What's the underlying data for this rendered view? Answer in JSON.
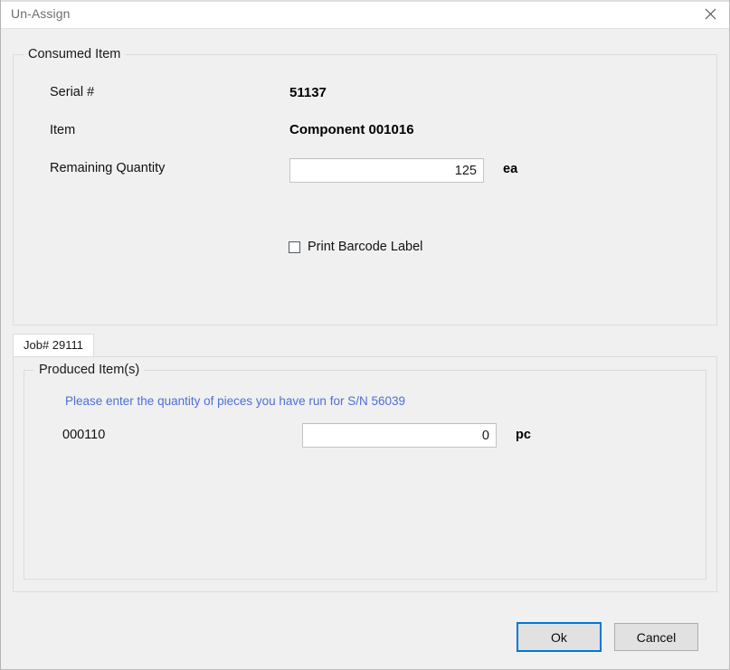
{
  "window": {
    "title": "Un-Assign",
    "close_icon": "close-icon",
    "accent_color": "#0078d7",
    "background_color": "#f0f0f0"
  },
  "consumed_section": {
    "legend": "Consumed Item",
    "fields": [
      {
        "label": "Serial #",
        "value": "51137"
      },
      {
        "label": "Item",
        "value": "Component 001016"
      }
    ],
    "quantity": {
      "label": "Remaining Quantity",
      "value": "125",
      "unit": "ea"
    },
    "print_barcode": {
      "label": "Print Barcode Label",
      "checked": false
    }
  },
  "tabs": [
    {
      "label": "Job# 29111",
      "selected": true
    }
  ],
  "produced_section": {
    "legend": "Produced Item(s)",
    "hint": "Please enter the quantity of pieces you have run for S/N 56039",
    "hint_color": "#4d6fd4",
    "rows": [
      {
        "item": "000110",
        "value": "0",
        "unit": "pc"
      }
    ]
  },
  "footer": {
    "ok_label": "Ok",
    "cancel_label": "Cancel"
  }
}
